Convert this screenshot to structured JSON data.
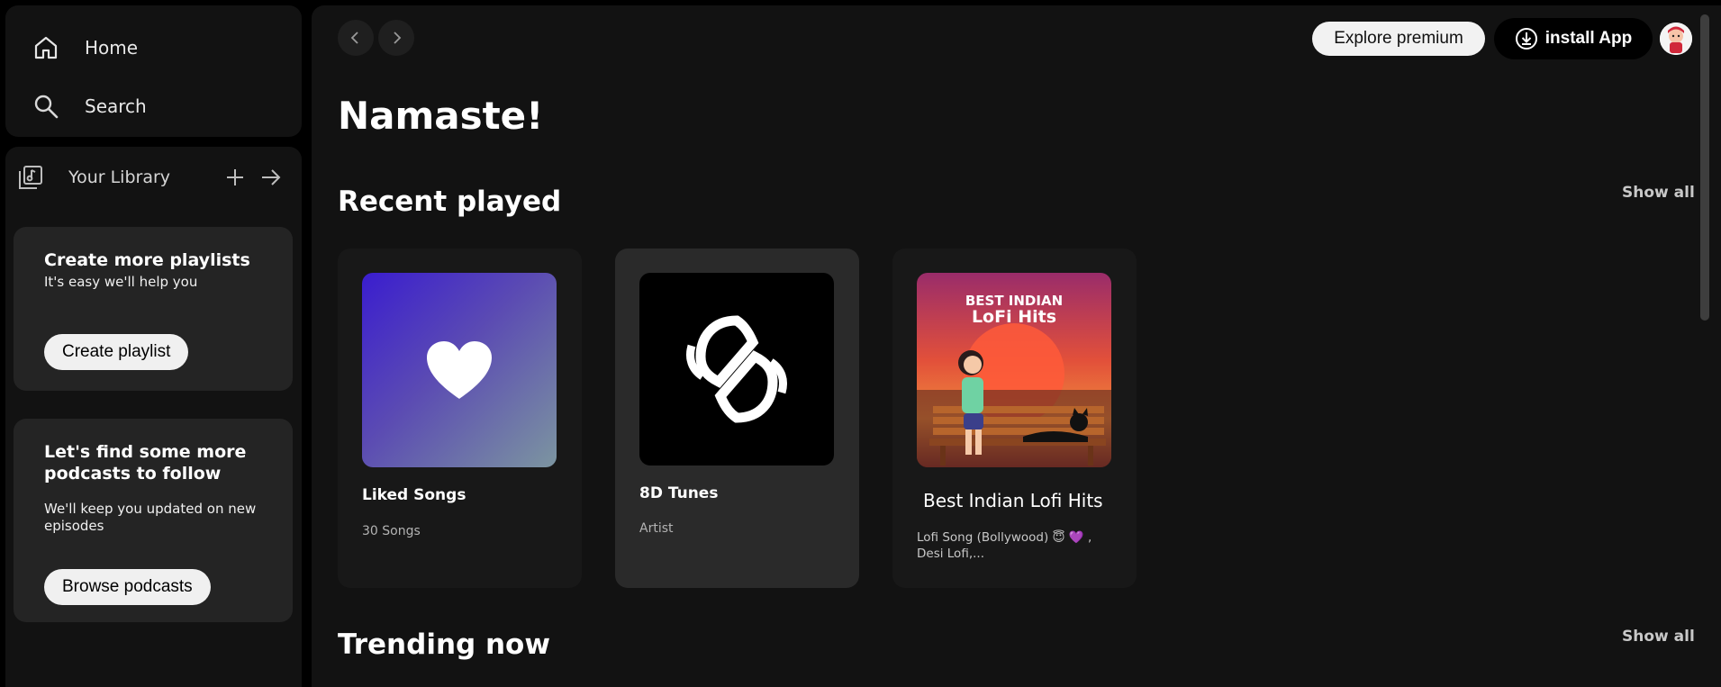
{
  "sidebar": {
    "nav": {
      "home": "Home",
      "search": "Search"
    },
    "library": {
      "title": "Your Library"
    },
    "cards": [
      {
        "title": "Create more playlists",
        "subtitle": "It's easy we'll help you",
        "button": "Create playlist"
      },
      {
        "title": "Let's find some more podcasts to follow",
        "subtitle": "We'll keep you updated on new episodes",
        "button": "Browse podcasts"
      }
    ]
  },
  "header": {
    "premium_label": "Explore premium",
    "install_label": "install App"
  },
  "main": {
    "greeting": "Namaste!",
    "sections": [
      {
        "title": "Recent played",
        "show_all": "Show all",
        "items": [
          {
            "title": "Liked Songs",
            "subtitle": "30 Songs",
            "cover_icon": "heart-icon"
          },
          {
            "title": "8D Tunes",
            "subtitle": "Artist",
            "cover_icon": "8d-logo"
          },
          {
            "title": "Best Indian Lofi Hits",
            "subtitle": "Lofi Song (Bollywood) 😇 💜 , Desi Lofi,...",
            "cover_title_top": "BEST INDIAN",
            "cover_title_bottom": "LoFi Hits"
          }
        ]
      },
      {
        "title": "Trending now",
        "show_all": "Show all"
      }
    ]
  },
  "colors": {
    "accent_purple": "#3a1dcf",
    "background": "#121212",
    "card": "#242424"
  }
}
